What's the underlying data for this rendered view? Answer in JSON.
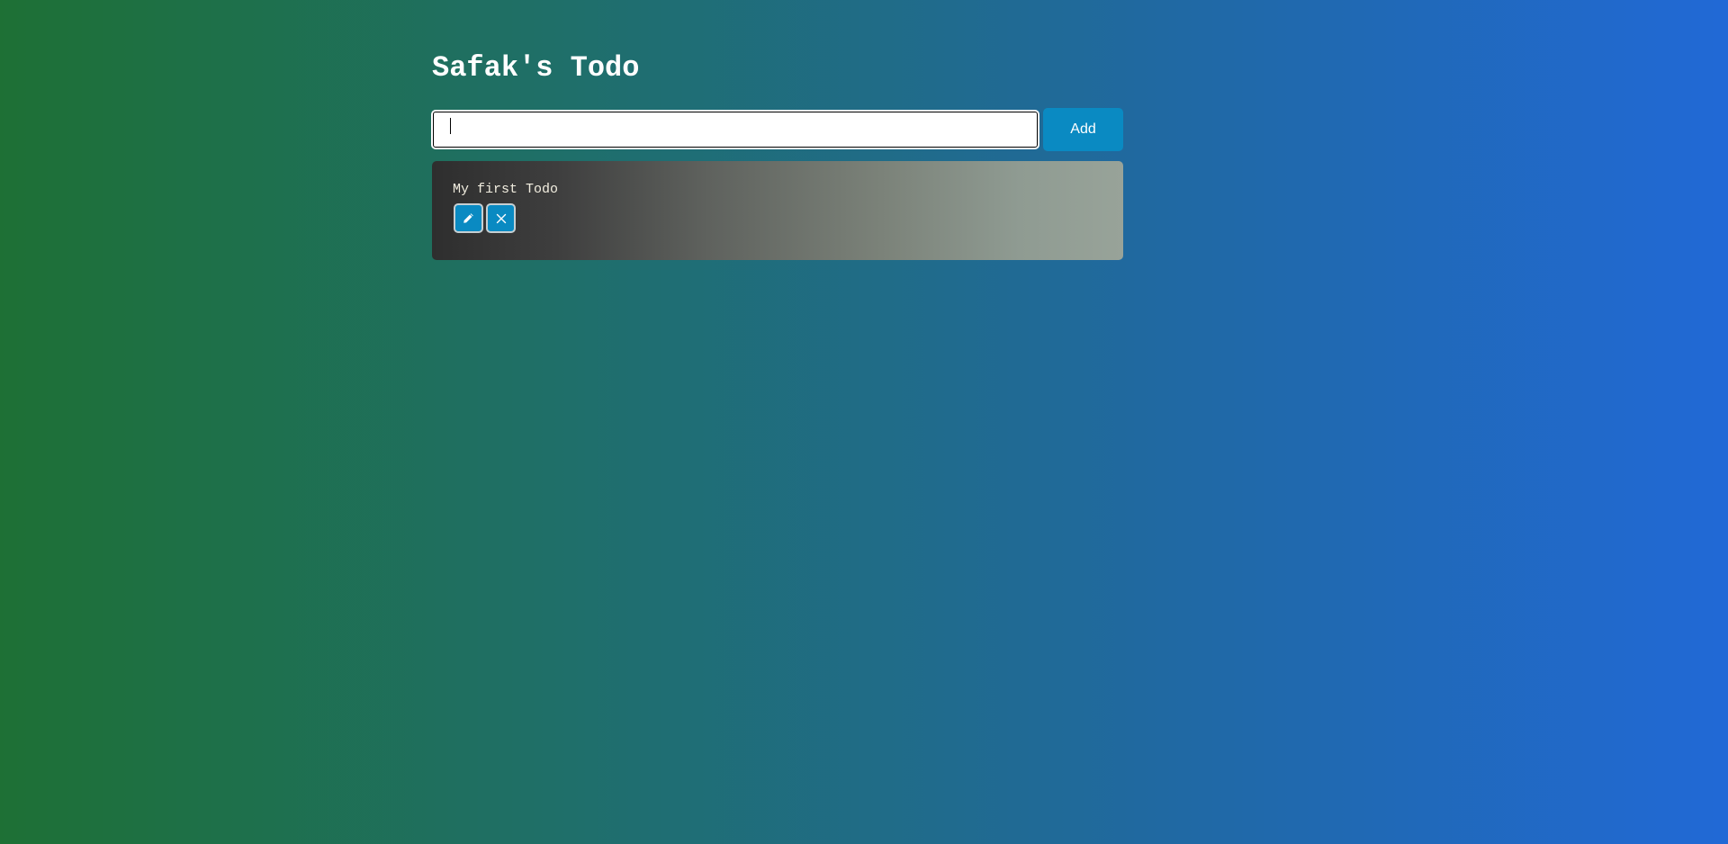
{
  "app": {
    "title": "Safak's Todo"
  },
  "add_form": {
    "input_value": "",
    "input_placeholder": "",
    "add_label": "Add"
  },
  "todos": [
    {
      "text": "My first Todo",
      "edit_icon": "pencil-icon",
      "delete_icon": "close-icon"
    }
  ],
  "colors": {
    "background_gradient_start": "#1e7035",
    "background_gradient_end": "#2169d6",
    "accent_button": "#0a8ac2",
    "todo_card_gradient_start": "#2e2e2e",
    "todo_card_gradient_end": "#98a399",
    "todo_text": "#f2eee0"
  }
}
